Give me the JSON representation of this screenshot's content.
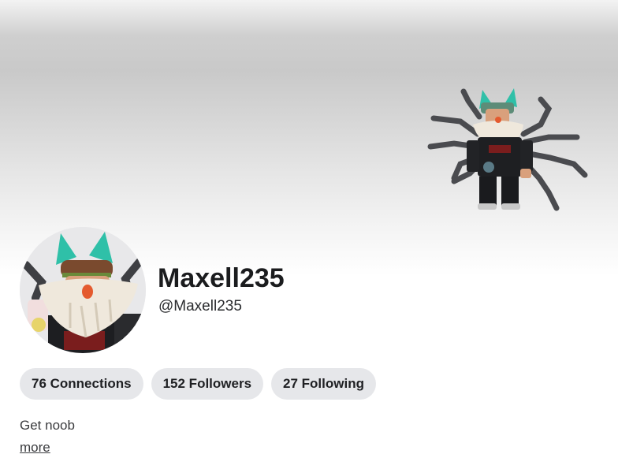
{
  "profile": {
    "display_name": "Maxell235",
    "username": "@Maxell235",
    "bio": "Get noob",
    "more_label": "more"
  },
  "stats": {
    "connections_label": "76 Connections",
    "followers_label": "152 Followers",
    "following_label": "27 Following"
  },
  "icons": {
    "avatar": "avatar-headshot",
    "banner_character": "full-body-avatar-render"
  },
  "colors": {
    "pill_bg": "#e6e7ea",
    "text": "#1b1c1e",
    "ear_teal": "#2fc0a8",
    "beard": "#efe8dc"
  }
}
